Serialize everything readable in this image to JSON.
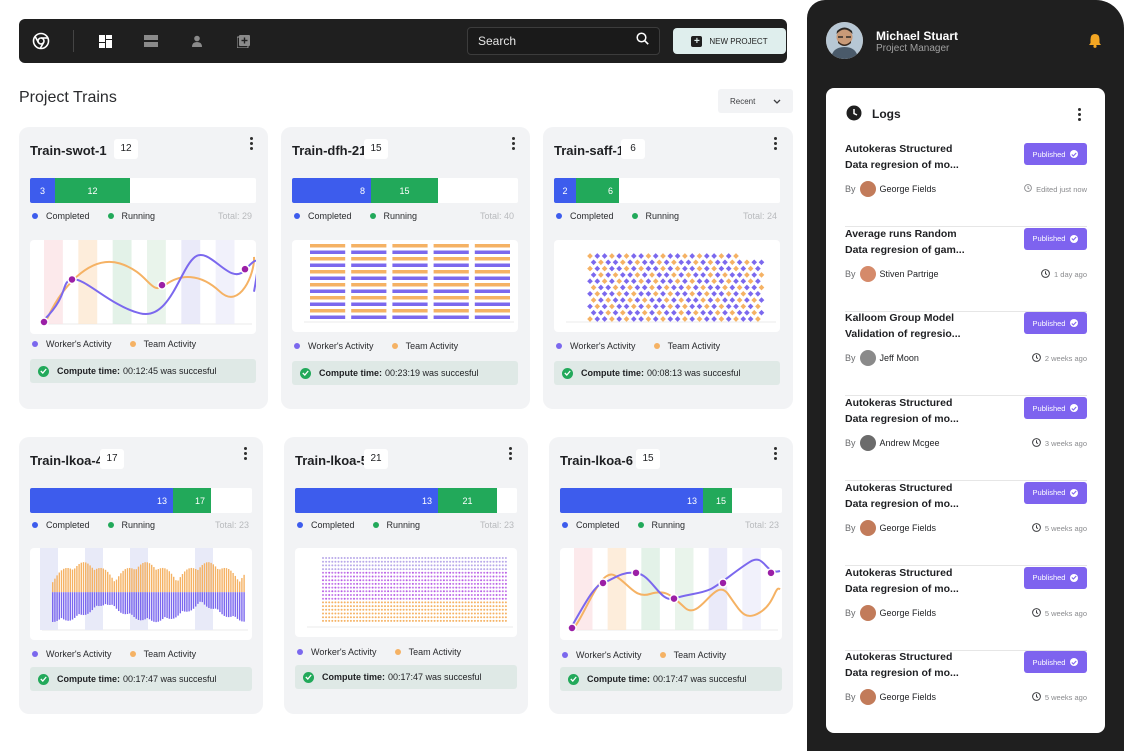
{
  "topbar": {
    "search_placeholder": "Search",
    "new_project_label": "NEW PROJECT",
    "icons": [
      "chrome-logo-icon",
      "dashboard-icon",
      "layers-icon",
      "user-icon",
      "add-box-icon"
    ]
  },
  "section": {
    "title": "Project Trains",
    "sort_label": "Recent"
  },
  "legend_labels": {
    "completed": "Completed",
    "running": "Running",
    "worker": "Worker's Activity",
    "team": "Team Activity",
    "compute_prefix": "Compute time:"
  },
  "colors": {
    "completed": "#3d5ced",
    "running": "#22a95a",
    "worker": "#7b68ee",
    "team": "#f5b264",
    "published": "#7e63ef"
  },
  "cards": [
    {
      "title": "Train-swot-1",
      "count": "12",
      "completed": "3",
      "running": "12",
      "total": "Total: 29",
      "compute": "00:12:45 was succesful",
      "chart": "curve"
    },
    {
      "title": "Train-dfh-21",
      "count": "15",
      "completed": "8",
      "running": "15",
      "total": "Total: 40",
      "compute": "00:23:19 was succesful",
      "chart": "stripes"
    },
    {
      "title": "Train-saff-1",
      "count": "6",
      "completed": "2",
      "running": "6",
      "total": "Total: 24",
      "compute": "00:08:13 was succesful",
      "chart": "diamonds"
    },
    {
      "title": "Train-lkoa-4",
      "count": "17",
      "completed": "13",
      "running": "17",
      "total": "Total: 23",
      "compute": "00:17:47 was succesful",
      "chart": "bars"
    },
    {
      "title": "Train-lkoa-5",
      "count": "21",
      "completed": "13",
      "running": "21",
      "total": "Total: 23",
      "compute": "00:17:47 was succesful",
      "chart": "dots"
    },
    {
      "title": "Train-lkoa-6",
      "count": "15",
      "completed": "13",
      "running": "15",
      "total": "Total: 23",
      "compute": "00:17:47 was succesful",
      "chart": "curve"
    }
  ],
  "user": {
    "name": "Michael Stuart",
    "role": "Project Manager"
  },
  "logs": {
    "title": "Logs",
    "by_label": "By",
    "published_label": "Published",
    "items": [
      {
        "line1": "Autokeras Structured",
        "line2": "Data regresion of mo...",
        "author": "George Fields",
        "time": "Edited just now"
      },
      {
        "line1": "Average runs Random",
        "line2": "Data regresion of gam...",
        "author": "Stiven Partrige",
        "time": "1 day ago"
      },
      {
        "line1": "Kalloom Group Model",
        "line2": "Validation of regresio...",
        "author": "Jeff Moon",
        "time": "2 weeks ago"
      },
      {
        "line1": "Autokeras Structured",
        "line2": "Data regresion of mo...",
        "author": "Andrew Mcgee",
        "time": "3 weeks ago"
      },
      {
        "line1": "Autokeras Structured",
        "line2": "Data regresion of mo...",
        "author": "George Fields",
        "time": "5 weeks ago"
      },
      {
        "line1": "Autokeras Structured",
        "line2": "Data regresion of mo...",
        "author": "George Fields",
        "time": "5 weeks ago"
      },
      {
        "line1": "Autokeras Structured",
        "line2": "Data regresion of mo...",
        "author": "George Fields",
        "time": "5 weeks ago"
      }
    ]
  }
}
